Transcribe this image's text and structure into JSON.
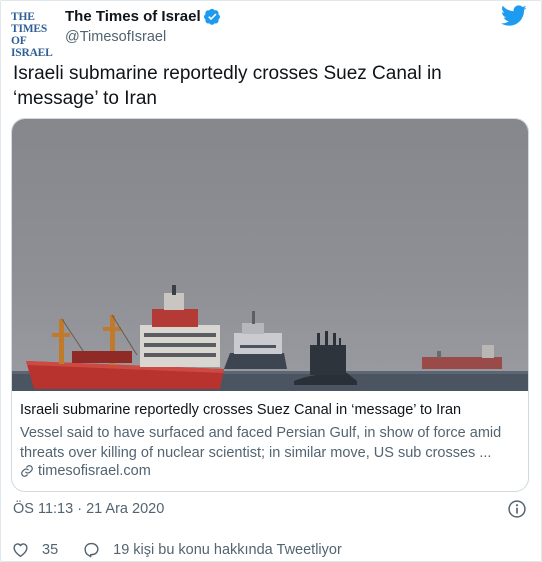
{
  "author": {
    "avatar_line1": "THE TIMES",
    "avatar_line2": "OF ISRAEL",
    "name": "The Times of Israel",
    "handle": "@TimesofIsrael"
  },
  "tweet": {
    "text": "Israeli submarine reportedly crosses Suez Canal in ‘message’ to Iran"
  },
  "link_card": {
    "title": "Israeli submarine reportedly crosses Suez Canal in ‘message’ to Iran",
    "description": "Vessel said to have surfaced and faced Persian Gulf, in show of force amid threats over killing of nuclear scientist; in similar move, US sub crosses ...",
    "domain": "timesofisrael.com"
  },
  "meta": {
    "timestamp": "ÖS 11:13 · 21 Ara 2020"
  },
  "actions": {
    "likes": "35",
    "conversation": "19 kişi bu konu hakkında Tweetliyor"
  },
  "colors": {
    "twitter_blue": "#1d9bf0",
    "avatar_blue": "#2f5f96",
    "secondary_text": "#536471"
  }
}
